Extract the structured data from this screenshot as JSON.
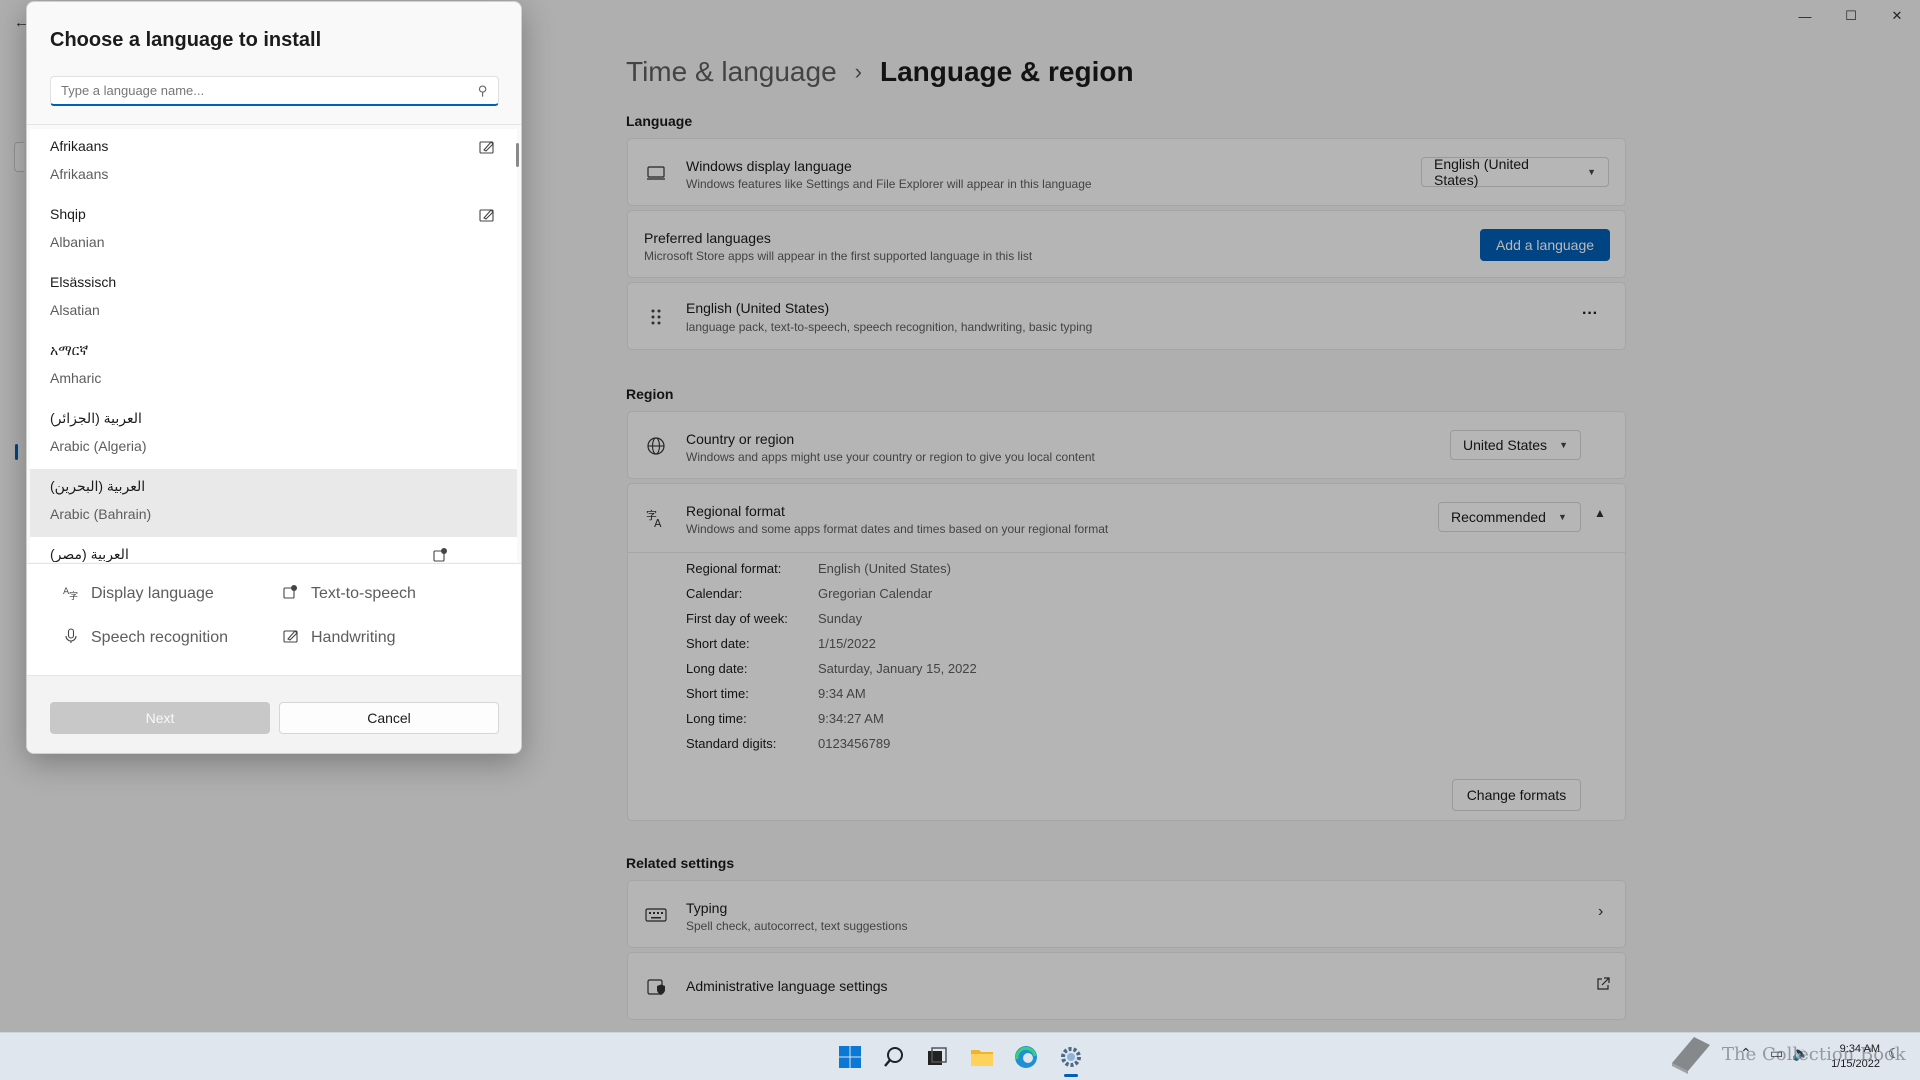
{
  "window": {
    "controls": [
      "—",
      "☐",
      "✕"
    ],
    "back": "←"
  },
  "breadcrumb": {
    "parent": "Time & language",
    "separator": "›",
    "current": "Language & region"
  },
  "language_section": {
    "title": "Language",
    "display_language": {
      "title": "Windows display language",
      "desc": "Windows features like Settings and File Explorer will appear in this language",
      "value": "English (United States)"
    },
    "preferred": {
      "title": "Preferred languages",
      "desc": "Microsoft Store apps will appear in the first supported language in this list",
      "button": "Add a language"
    },
    "installed": {
      "title": "English (United States)",
      "desc": "language pack, text-to-speech, speech recognition, handwriting, basic typing",
      "more": "···"
    }
  },
  "region_section": {
    "title": "Region",
    "country": {
      "title": "Country or region",
      "desc": "Windows and apps might use your country or region to give you local content",
      "value": "United States"
    },
    "format": {
      "title": "Regional format",
      "desc": "Windows and some apps format dates and times based on your regional format",
      "value": "Recommended",
      "details": [
        {
          "k": "Regional format:",
          "v": "English (United States)"
        },
        {
          "k": "Calendar:",
          "v": "Gregorian Calendar"
        },
        {
          "k": "First day of week:",
          "v": "Sunday"
        },
        {
          "k": "Short date:",
          "v": "1/15/2022"
        },
        {
          "k": "Long date:",
          "v": "Saturday, January 15, 2022"
        },
        {
          "k": "Short time:",
          "v": "9:34 AM"
        },
        {
          "k": "Long time:",
          "v": "9:34:27 AM"
        },
        {
          "k": "Standard digits:",
          "v": "0123456789"
        }
      ],
      "change_button": "Change formats"
    }
  },
  "related": {
    "title": "Related settings",
    "typing": {
      "title": "Typing",
      "desc": "Spell check, autocorrect, text suggestions"
    },
    "admin": {
      "title": "Administrative language settings"
    }
  },
  "dialog": {
    "title": "Choose a language to install",
    "search_placeholder": "Type a language name...",
    "languages": [
      {
        "native": "Afrikaans",
        "english": "Afrikaans",
        "feature_icon": "handwriting-icon"
      },
      {
        "native": "Shqip",
        "english": "Albanian",
        "feature_icon": "handwriting-icon"
      },
      {
        "native": "Elsässisch",
        "english": "Alsatian",
        "feature_icon": ""
      },
      {
        "native": "አማርኛ",
        "english": "Amharic",
        "feature_icon": ""
      },
      {
        "native": "العربية (الجزائر)",
        "english": "Arabic (Algeria)",
        "feature_icon": ""
      },
      {
        "native": "العربية (البحرين)",
        "english": "Arabic (Bahrain)",
        "feature_icon": "",
        "selected": true
      },
      {
        "native": "العربية (مصر)",
        "english": "",
        "feature_icon": "text-to-speech-icon"
      }
    ],
    "legend": {
      "display_language": "Display language",
      "text_to_speech": "Text-to-speech",
      "speech_recognition": "Speech recognition",
      "handwriting": "Handwriting"
    },
    "next": "Next",
    "cancel": "Cancel"
  },
  "taskbar": {
    "apps": [
      "start-icon",
      "search-icon",
      "task-view-icon",
      "file-explorer-icon",
      "edge-icon",
      "settings-icon"
    ],
    "time": "9:34 AM",
    "date": "1/15/2022"
  },
  "watermark": "The Collection Book",
  "colors": {
    "accent": "#005fb8",
    "background": "#f3f3f3",
    "card": "#fbfbfb"
  }
}
